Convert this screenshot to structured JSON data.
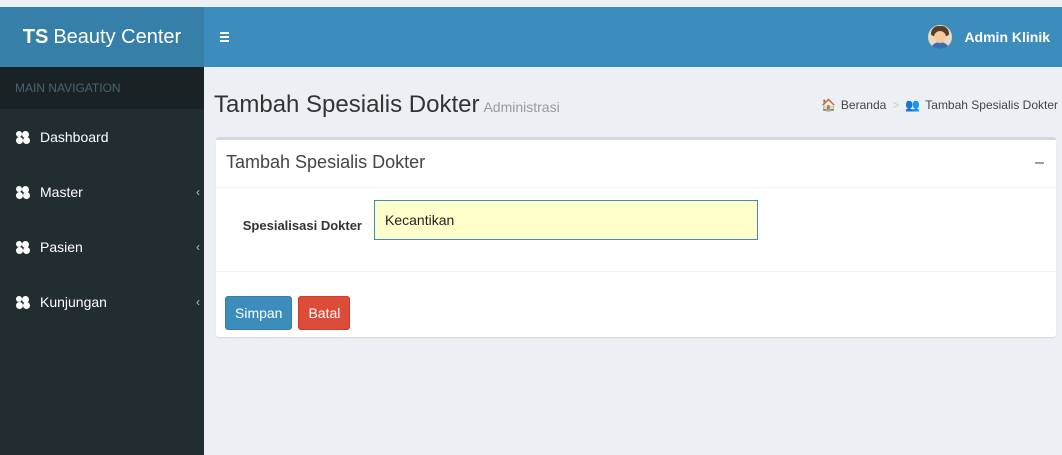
{
  "app": {
    "brand_bold": "TS",
    "brand_rest": "Beauty Center"
  },
  "header": {
    "toggle_icon": "hamburger-icon",
    "user_name": "Admin Klinik"
  },
  "sidebar": {
    "header": "MAIN NAVIGATION",
    "items": [
      {
        "label": "Dashboard",
        "icon": "users-icon",
        "has_children": false
      },
      {
        "label": "Master",
        "icon": "users-icon",
        "has_children": true
      },
      {
        "label": "Pasien",
        "icon": "users-icon",
        "has_children": true
      },
      {
        "label": "Kunjungan",
        "icon": "users-icon",
        "has_children": true
      }
    ],
    "chevron": "‹"
  },
  "page": {
    "title": "Tambah Spesialis Dokter",
    "subtitle": "Administrasi"
  },
  "breadcrumb": {
    "home_icon": "🏠",
    "home": "Beranda",
    "separator": ">",
    "current_icon": "👥",
    "current": "Tambah Spesialis Dokter"
  },
  "box": {
    "title": "Tambah Spesialis Dokter",
    "field_label": "Spesialisasi Dokter",
    "field_value": "Kecantikan",
    "save_label": "Simpan",
    "cancel_label": "Batal"
  },
  "colors": {
    "header": "#3c8dbc",
    "logo": "#367fa9",
    "sidebar": "#222d32",
    "danger": "#dd4b39"
  }
}
